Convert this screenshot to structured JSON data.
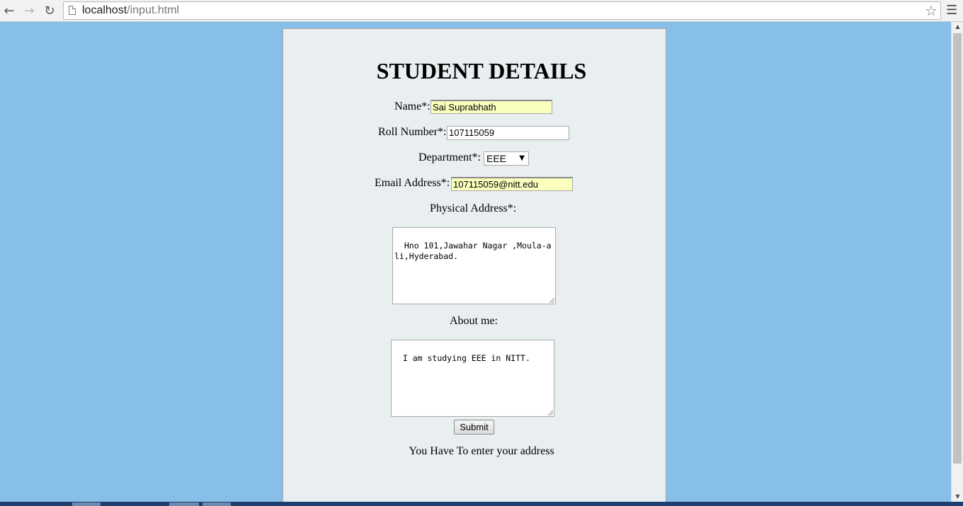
{
  "browser": {
    "url_host": "localhost",
    "url_path": "/input.html"
  },
  "form": {
    "title": "STUDENT DETAILS",
    "name_label": "Name*:",
    "name_value": "Sai Suprabhath",
    "roll_label": "Roll Number*:",
    "roll_value": "107115059",
    "department_label": "Department*:",
    "department_value": "EEE",
    "email_label": "Email Address*:",
    "email_value": "107115059@nitt.edu",
    "address_label": "Physical Address*:",
    "address_value": "Hno 101,Jawahar Nagar ,Moula-ali,Hyderabad.",
    "about_label": "About me:",
    "about_value": "I am studying EEE in NITT.",
    "submit_label": "Submit",
    "message": "You Have To enter your address"
  },
  "colors": {
    "page_background": "#87bfe8",
    "panel_background": "#e9eef0",
    "autofill_background": "#faffbd"
  }
}
